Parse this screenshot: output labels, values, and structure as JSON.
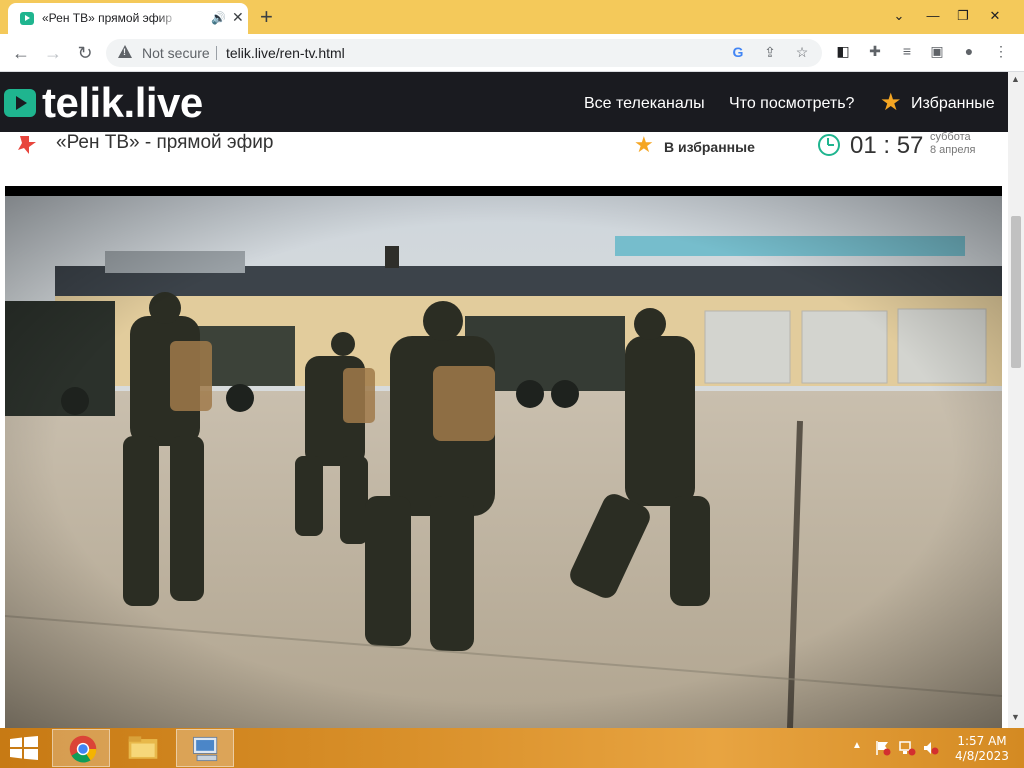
{
  "browser": {
    "tab_title": "«Рен ТВ» прямой эфир - смотреть онлайн",
    "new_tab": "+",
    "security_label": "Not secure",
    "url": "telik.live/ren-tv.html"
  },
  "site": {
    "logo_text": "telik.live",
    "nav": {
      "all_channels": "Все телеканалы",
      "what_to_watch": "Что посмотреть?",
      "favorites": "Избранные"
    }
  },
  "channel": {
    "title": "«Рен ТВ» - прямой эфир",
    "add_favorite": "В избранные",
    "time": "01 : 57",
    "weekday": "суббота",
    "date": "8 апреля"
  },
  "taskbar": {
    "time": "1:57 AM",
    "date": "4/8/2023"
  },
  "colors": {
    "accent": "#1fb58f",
    "star": "#f5a623",
    "header_bg": "#1a1b20",
    "tabstrip": "#f4c95a"
  }
}
